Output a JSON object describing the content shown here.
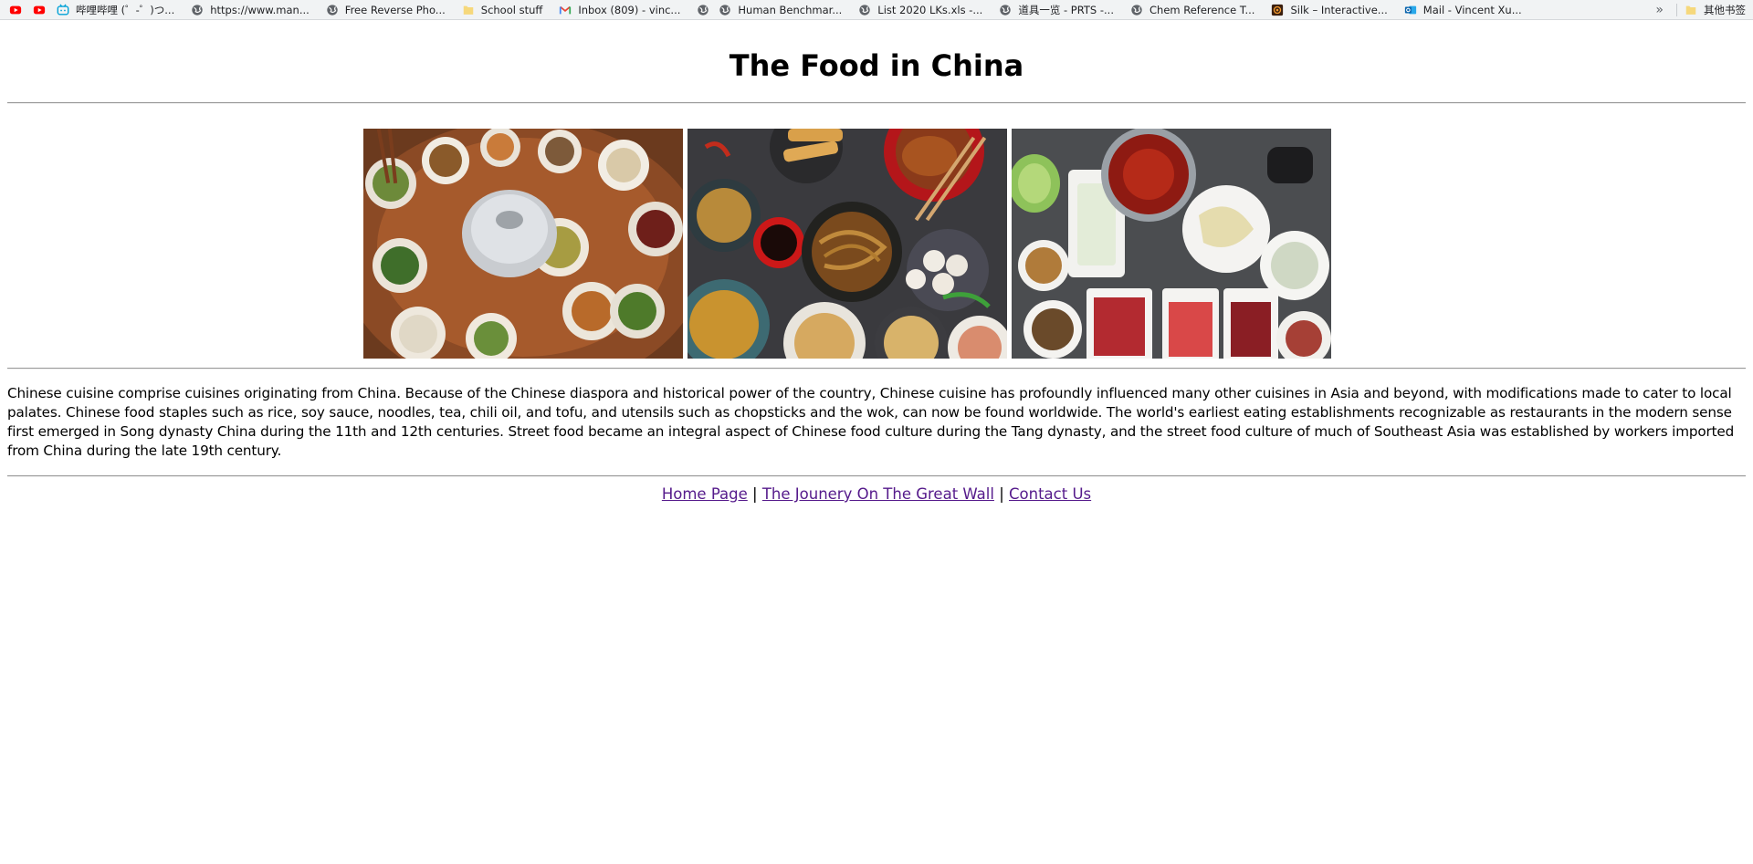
{
  "bookmarks": {
    "items": [
      {
        "label": "",
        "icon": "youtube-icon"
      },
      {
        "label": "",
        "icon": "youtube-icon"
      },
      {
        "label": "哔哩哔哩 (゜-゜)つ...",
        "icon": "bilibili-icon"
      },
      {
        "label": "https://www.man...",
        "icon": "globe-icon"
      },
      {
        "label": "Free Reverse Pho...",
        "icon": "globe-icon"
      },
      {
        "label": "School stuff",
        "icon": "folder-icon"
      },
      {
        "label": "Inbox (809) - vinc...",
        "icon": "gmail-icon"
      },
      {
        "label": "",
        "icon": "globe-icon"
      },
      {
        "label": "Human Benchmar...",
        "icon": "globe-icon"
      },
      {
        "label": "List 2020 LKs.xls -...",
        "icon": "globe-icon"
      },
      {
        "label": "道具一览 - PRTS -...",
        "icon": "globe-icon"
      },
      {
        "label": "Chem Reference T...",
        "icon": "globe-icon"
      },
      {
        "label": "Silk – Interactive...",
        "icon": "silk-icon"
      },
      {
        "label": "Mail - Vincent Xu...",
        "icon": "outlook-icon"
      }
    ],
    "overflow": "»",
    "other_bookmarks": "其他书签"
  },
  "page": {
    "title": "The Food in China",
    "images": [
      {
        "name": "hotpot-banquet-image"
      },
      {
        "name": "noodles-dumplings-image"
      },
      {
        "name": "spicy-hotpot-image"
      }
    ],
    "description": "Chinese cuisine comprise cuisines originating from China. Because of the Chinese diaspora and historical power of the country, Chinese cuisine has profoundly influenced many other cuisines in Asia and beyond, with modifications made to cater to local palates. Chinese food staples such as rice, soy sauce, noodles, tea, chili oil, and tofu, and utensils such as chopsticks and the wok, can now be found worldwide. The world's earliest eating establishments recognizable as restaurants in the modern sense first emerged in Song dynasty China during the 11th and 12th centuries. Street food became an integral aspect of Chinese food culture during the Tang dynasty, and the street food culture of much of Southeast Asia was established by workers imported from China during the late 19th century.",
    "nav": {
      "home": "Home Page",
      "great_wall": "The Jounery On The Great Wall",
      "contact": "Contact Us",
      "separator": "|"
    }
  },
  "colors": {
    "visited_link": "#551a8b",
    "bookmarks_bg": "#f1f3f4"
  }
}
